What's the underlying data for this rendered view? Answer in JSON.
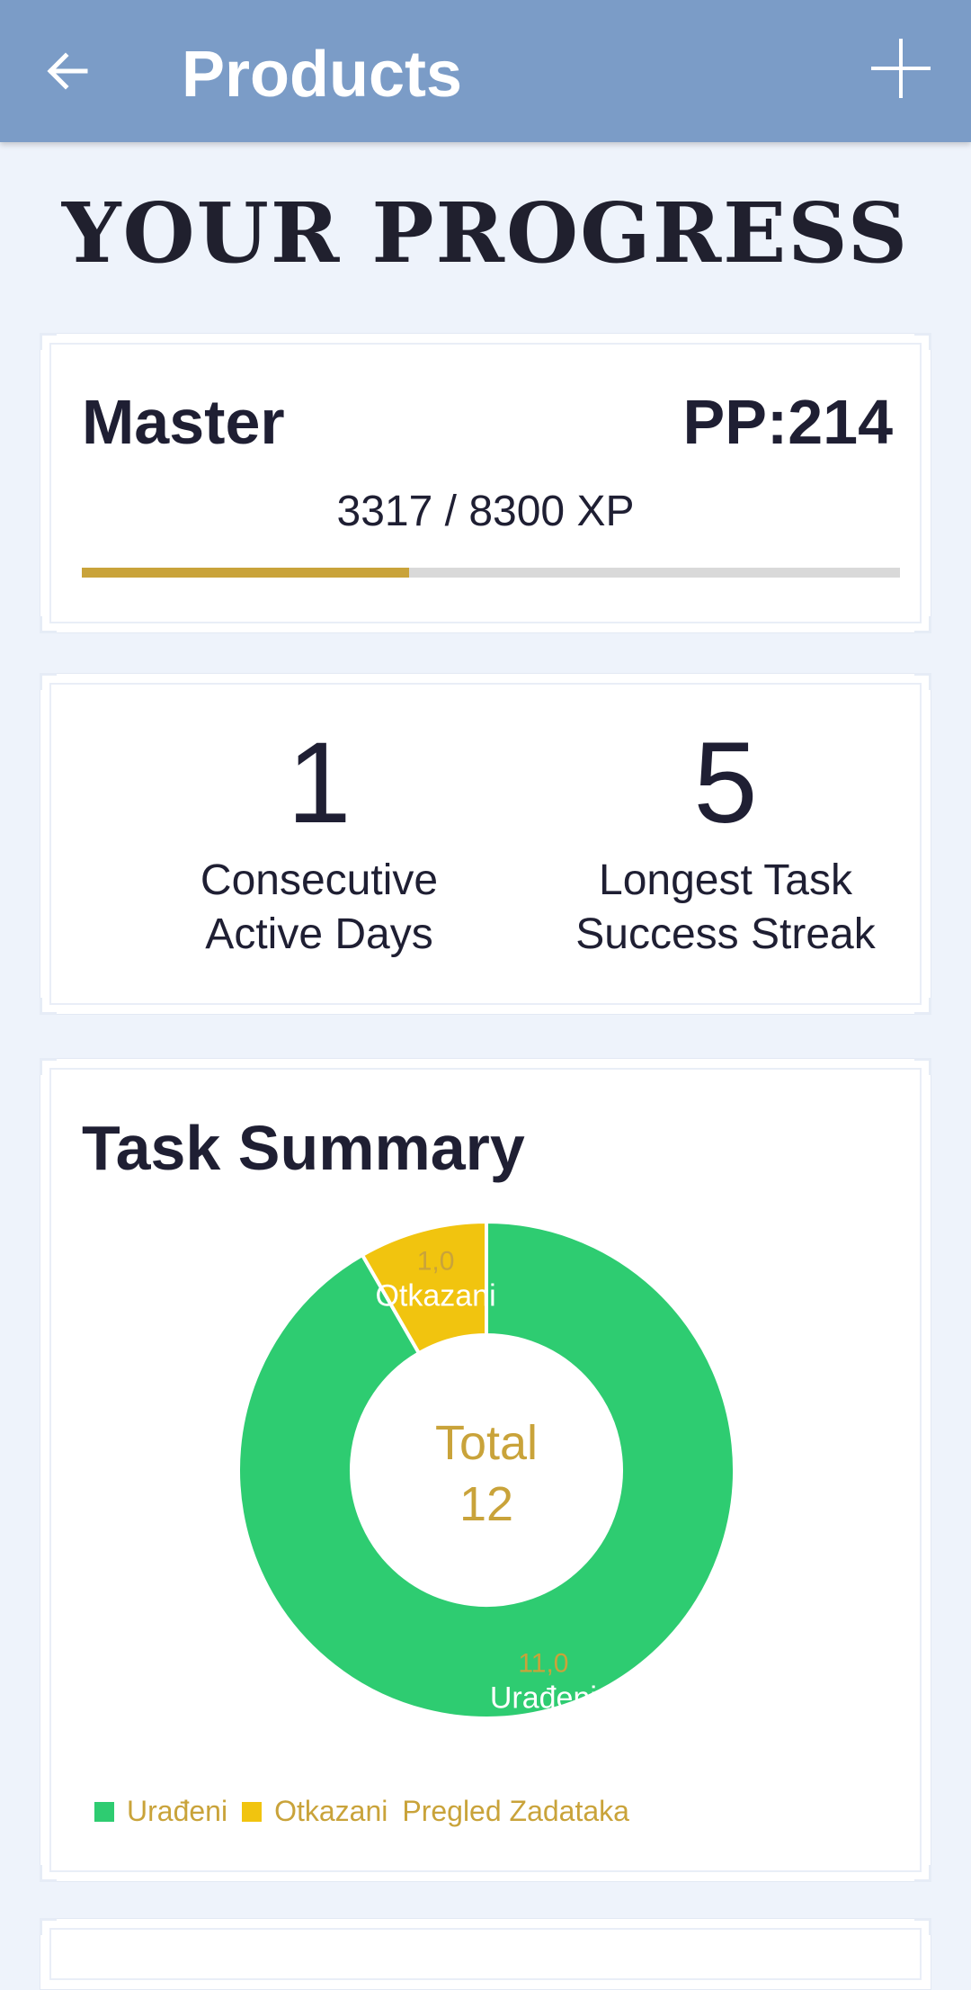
{
  "appbar": {
    "title": "Products",
    "back_icon": "arrow-left-icon",
    "add_icon": "plus-icon",
    "color": "#7b9cc7"
  },
  "heading": "YOUR PROGRESS",
  "rank": {
    "name": "Master",
    "pp": "PP:214",
    "xp_text": "3317 / 8300 XP",
    "xp_current": 3317,
    "xp_max": 8300,
    "bar_color": "#c9a33a"
  },
  "stats": [
    {
      "value": "1",
      "label_line1": "Consecutive",
      "label_line2": "Active Days"
    },
    {
      "value": "5",
      "label_line1": "Longest Task",
      "label_line2": "Success Streak"
    }
  ],
  "summary": {
    "title": "Task Summary",
    "center_label": "Total",
    "center_value": "12"
  },
  "chart_data": {
    "type": "pie",
    "title": "",
    "donut": true,
    "categories": [
      "Urađeni",
      "Otkazani"
    ],
    "values": [
      11.0,
      1.0
    ],
    "value_labels": [
      "11,0",
      "1,0"
    ],
    "colors": [
      "#2ecc71",
      "#f1c40f"
    ],
    "total": 12,
    "legend": [
      "Urađeni",
      "Otkazani",
      "Pregled Zadataka"
    ],
    "legend_position": "bottom-left"
  }
}
